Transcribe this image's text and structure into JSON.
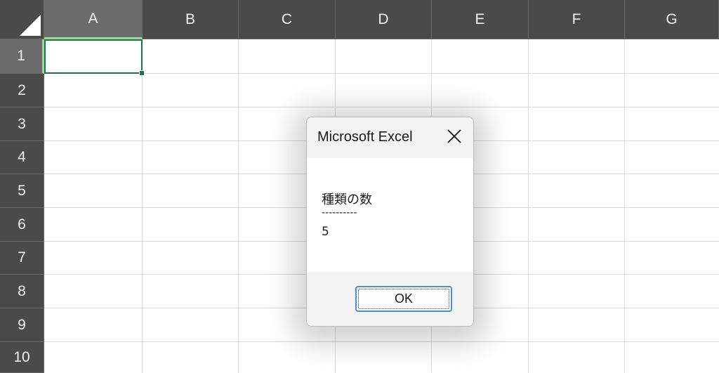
{
  "spreadsheet": {
    "columns": [
      "A",
      "B",
      "C",
      "D",
      "E",
      "F",
      "G"
    ],
    "rows": [
      "1",
      "2",
      "3",
      "4",
      "5",
      "6",
      "7",
      "8",
      "9",
      "10"
    ],
    "selected_cell": "A1",
    "colors": {
      "header_bg": "#4a4a4a",
      "header_selected_bg": "#6b6b6b",
      "header_text": "#f0f0f0",
      "gridline": "#d9d9d9",
      "active_cell_border": "#217346"
    }
  },
  "dialog": {
    "title": "Microsoft Excel",
    "close_icon": "close-icon",
    "message_lines": [
      "種類の数",
      "----------",
      "5"
    ],
    "ok_label": "OK",
    "colors": {
      "title_bg": "#f3f3f3",
      "footer_bg": "#f3f3f3",
      "button_focus_border": "#4a90d9"
    }
  }
}
